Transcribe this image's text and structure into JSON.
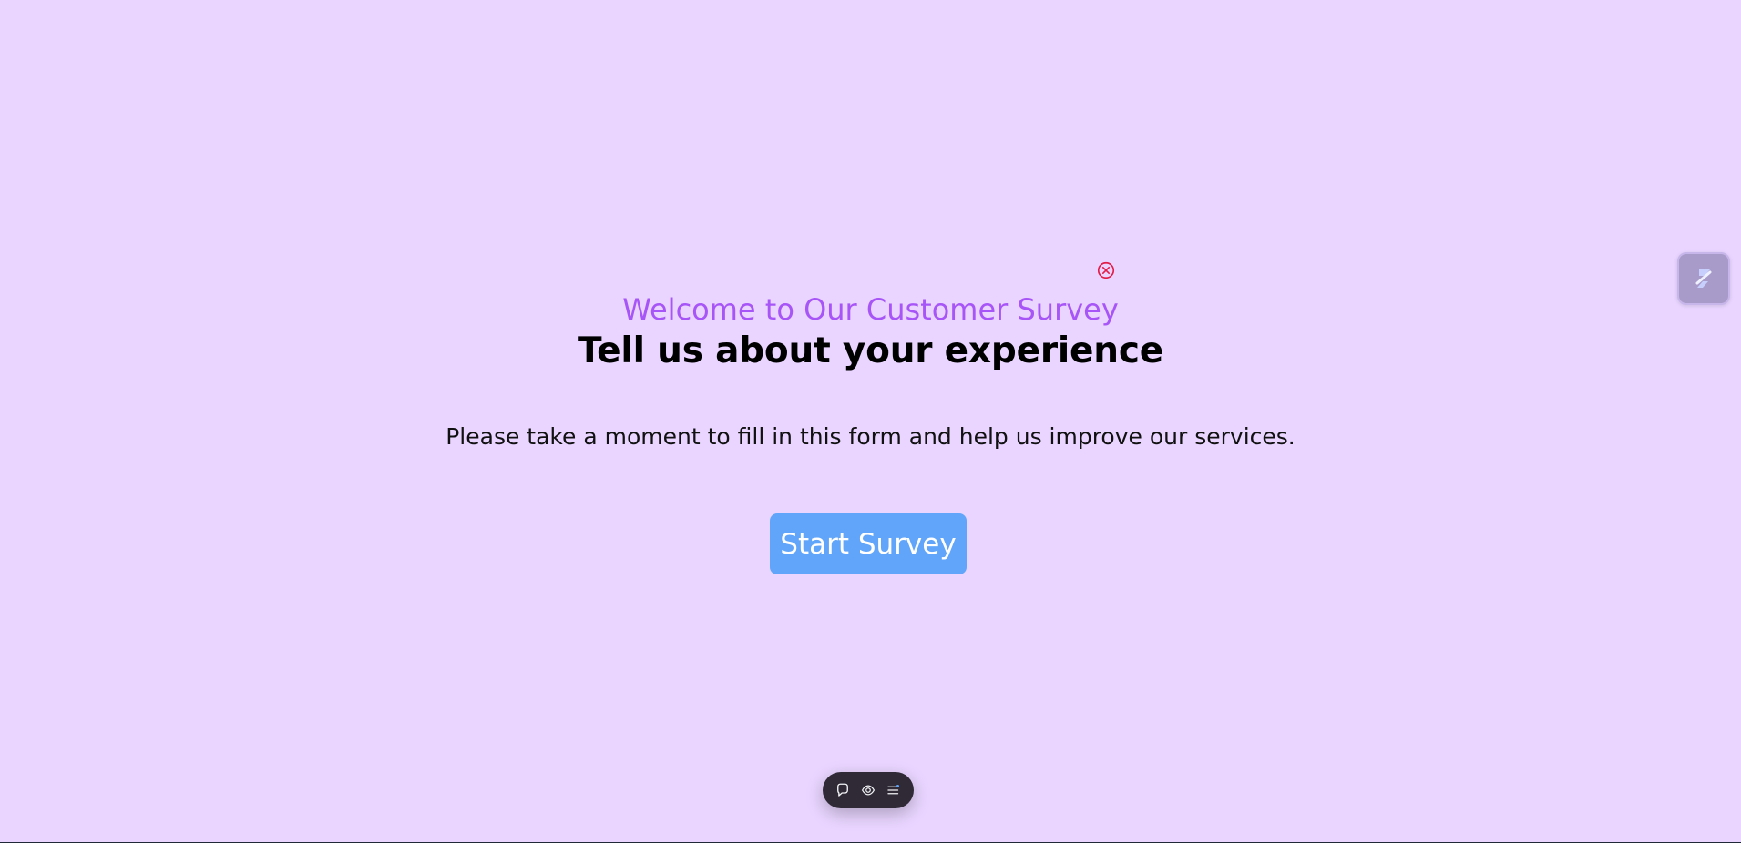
{
  "survey": {
    "subtitle": "Welcome to Our Customer Survey",
    "title": "Tell us about your experience",
    "description": "Please take a moment to fill in this form and help us improve our services.",
    "start_button_label": "Start Survey"
  },
  "icons": {
    "close": "close-circle-icon",
    "side_widget": "slash-logo-icon",
    "toolbar": [
      "chat-bubble-icon",
      "eye-icon",
      "list-menu-icon"
    ]
  },
  "colors": {
    "background": "#e9d5ff",
    "subtitle": "#a855f7",
    "button": "#60a5fa",
    "close_icon": "#e11d48",
    "toolbar": "#2f2a36"
  }
}
